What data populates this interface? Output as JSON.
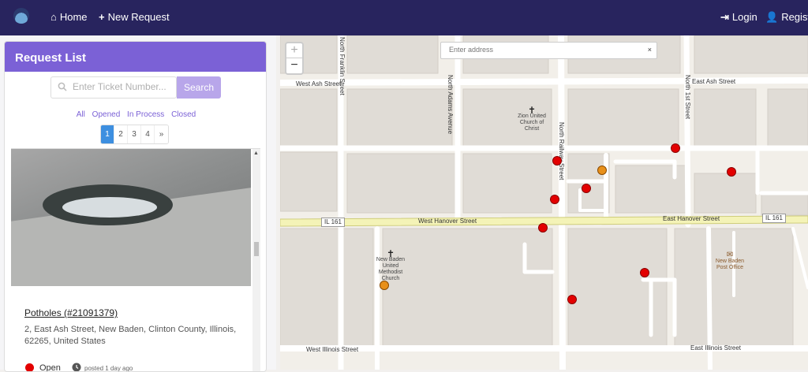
{
  "nav": {
    "home": "Home",
    "new_request": "New Request",
    "login": "Login",
    "register": "Registe"
  },
  "sidebar": {
    "title": "Request List",
    "search_placeholder": "Enter Ticket Number...",
    "search_button": "Search",
    "filters": [
      "All",
      "Opened",
      "In Process",
      "Closed"
    ],
    "pages": [
      "1",
      "2",
      "3",
      "4",
      "»"
    ],
    "active_page": "1"
  },
  "card": {
    "title": "Potholes (#21091379)",
    "address": "2, East Ash Street, New Baden, Clinton County, Illinois, 62265, United States",
    "status": "Open",
    "posted": "posted 1 day ago",
    "status_color": "#e30000"
  },
  "map": {
    "zoom_in": "+",
    "zoom_out": "−",
    "address_placeholder": "Enter address",
    "clear": "×",
    "streets": {
      "west_ash": "West Ash Street",
      "east_ash": "East Ash Street",
      "north_franklin": "North Franklin Street",
      "north_adams": "North Adams Avenue",
      "north_railway": "North Railway Street",
      "north_1st": "North 1st Street",
      "west_hanover": "West Hanover Street",
      "east_hanover": "East Hanover Street",
      "west_illinois": "West Illinois Street",
      "east_illinois": "East Illinois Street"
    },
    "route_shield": "IL 161",
    "pois": {
      "zion": "Zion United Church of Christ",
      "methodist": "New Baden United Methodist Church",
      "post_office": "New Baden Post Office"
    },
    "marker_colors": {
      "open": "#e30000",
      "in_process": "#e8901a"
    }
  }
}
